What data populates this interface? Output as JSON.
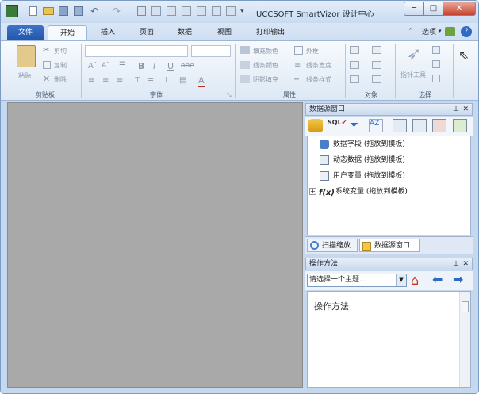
{
  "window": {
    "title": "UCCSOFT SmartVizor 设计中心",
    "quick_access": [
      "app-icon",
      "new-icon",
      "open-icon",
      "save-icon",
      "save-as-icon",
      "undo-icon",
      "redo-icon",
      "page-icon",
      "cut-icon",
      "copy-icon",
      "paste-icon",
      "print-icon",
      "preview-icon",
      "customize-icon"
    ]
  },
  "tabs": [
    "文件",
    "开始",
    "插入",
    "页面",
    "数据",
    "视图",
    "打印输出"
  ],
  "ribbon_right": {
    "options_label": "选项"
  },
  "ribbon": {
    "clipboard": {
      "paste": "粘贴",
      "cut": "剪切",
      "copy": "复制",
      "delete": "删除",
      "group": "剪贴板"
    },
    "font": {
      "bold": "B",
      "italic": "I",
      "underline": "U",
      "strike": "abe",
      "color": "A",
      "group": "字体"
    },
    "properties": {
      "fill_color": "填充颜色",
      "line_color": "线条颜色",
      "shadow_fill": "阴影填充",
      "border": "外框",
      "line_width": "线条宽度",
      "line_style": "线条样式",
      "group": "属性"
    },
    "objects": {
      "group": "对象"
    },
    "select": {
      "pointer_tool": "指针工具",
      "group": "选择"
    }
  },
  "ds_pane": {
    "title": "数据源窗口",
    "tree": [
      {
        "label": "数据字段 (拖放到模板)",
        "icon": "db-field-icon"
      },
      {
        "label": "动态数据 (拖放到模板)",
        "icon": "dynamic-data-icon"
      },
      {
        "label": "用户变量 (拖放到模板)",
        "icon": "user-var-icon"
      },
      {
        "label": "系统变量 (拖放到模板)",
        "icon": "sys-var-icon"
      }
    ],
    "dock_tabs": [
      "扫描缩放",
      "数据源窗口"
    ]
  },
  "help_pane": {
    "title": "操作方法",
    "topic_placeholder": "请选择一个主题...",
    "body_title": "操作方法"
  },
  "colors": {
    "accent": "#2a5fb4",
    "canvas": "#a9a9a9"
  }
}
